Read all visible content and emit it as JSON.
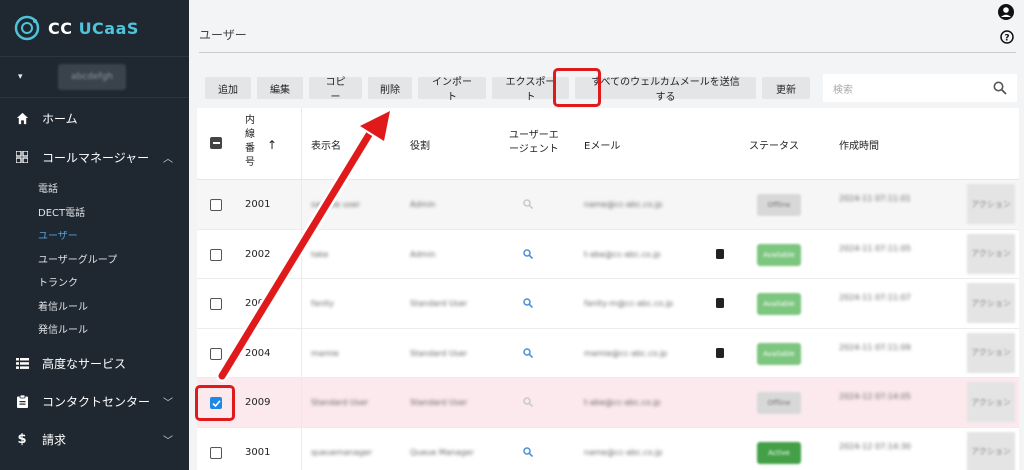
{
  "app": {
    "logo_cc": "CC ",
    "logo_name": "UCaaS"
  },
  "account": {
    "caret": "▾",
    "name": "abcdefgh"
  },
  "sidebar": {
    "home": "ホーム",
    "call_manager": "コールマネージャー",
    "sub_items": [
      "電話",
      "DECT電話",
      "ユーザー",
      "ユーザーグループ",
      "トランク",
      "着信ルール",
      "発信ルール"
    ],
    "active_sub": "ユーザー",
    "advanced": "高度なサービス",
    "contact_center": "コンタクトセンター",
    "billing": "請求"
  },
  "page": {
    "title": "ユーザー"
  },
  "toolbar": {
    "add": "追加",
    "edit": "編集",
    "copy": "コピー",
    "delete": "削除",
    "import": "インポート",
    "export": "エクスポート",
    "send_welcome": "すべてのウェルカムメールを送信する",
    "refresh": "更新"
  },
  "search": {
    "placeholder": "検索"
  },
  "table": {
    "headers": {
      "extension": "内線番号",
      "display_name": "表示名",
      "role": "役割",
      "user_agent_1": "ユーザーエ",
      "user_agent_2": "ージェント",
      "email": "Eメール",
      "status": "ステータス",
      "created": "作成時間"
    },
    "sort_arrow": "↑",
    "rows": [
      {
        "ext": "2001",
        "name": "sample user",
        "role": "Admin",
        "email": "name@cc-abc.co.jp",
        "status": "Offline",
        "created": "2024-11 07:11:01",
        "action": "アクション",
        "selected": false
      },
      {
        "ext": "2002",
        "name": "take",
        "role": "Admin",
        "email": "t-abe@cc-abc.co.jp",
        "status": "Available",
        "created": "2024-11 07:11:05",
        "action": "アクション",
        "selected": false
      },
      {
        "ext": "2003",
        "name": "fanity",
        "role": "Standard User",
        "email": "fanity-m@cc-abc.co.jp",
        "status": "Available",
        "created": "2024-11 07:11:07",
        "action": "アクション",
        "selected": false
      },
      {
        "ext": "2004",
        "name": "mamie",
        "role": "Standard User",
        "email": "mamie@cc-abc.co.jp",
        "status": "Available",
        "created": "2024-11 07:11:09",
        "action": "アクション",
        "selected": false
      },
      {
        "ext": "2009",
        "name": "Standard User",
        "role": "Standard User",
        "email": "t-abe@cc-abc.co.jp",
        "status": "Offline",
        "created": "2024-12 07:14:05",
        "action": "アクション",
        "selected": true
      },
      {
        "ext": "3001",
        "name": "queuemanager",
        "role": "Queue Manager",
        "email": "name@cc-abc.co.jp",
        "status": "Active",
        "created": "2024-12 07:14:30",
        "action": "アクション",
        "selected": false
      }
    ]
  },
  "colors": {
    "sidebar_bg": "#1f2730",
    "accent": "#4fa3e0",
    "highlight": "#e01a1a",
    "status_green": "#6fbf73"
  }
}
